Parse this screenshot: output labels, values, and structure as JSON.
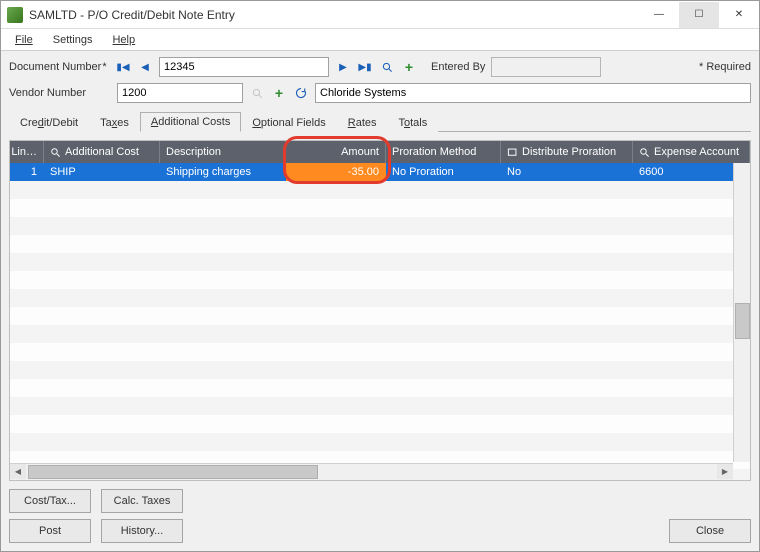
{
  "window": {
    "title": "SAMLTD - P/O Credit/Debit Note Entry"
  },
  "menu": {
    "file": "File",
    "settings": "Settings",
    "help": "Help"
  },
  "header": {
    "doc_label": "Document Number",
    "doc_value": "12345",
    "entered_by_label": "Entered By",
    "entered_by_value": "",
    "required_hint": "Required",
    "vendor_label": "Vendor Number",
    "vendor_value": "1200",
    "vendor_name": "Chloride Systems"
  },
  "tabs": [
    {
      "label": "Credit/Debit"
    },
    {
      "label": "Taxes"
    },
    {
      "label": "Additional Costs"
    },
    {
      "label": "Optional Fields"
    },
    {
      "label": "Rates"
    },
    {
      "label": "Totals"
    }
  ],
  "grid": {
    "columns": {
      "lin": "Lin…",
      "addcost": "Additional Cost",
      "desc": "Description",
      "amount": "Amount",
      "proration": "Proration Method",
      "distribute": "Distribute Proration",
      "expense": "Expense Account"
    },
    "rows": [
      {
        "line": "1",
        "addcost": "SHIP",
        "desc": "Shipping charges",
        "amount": "-35.00",
        "proration": "No Proration",
        "distribute": "No",
        "expense": "6600"
      }
    ]
  },
  "buttons": {
    "cost_tax": "Cost/Tax...",
    "calc_taxes": "Calc. Taxes",
    "post": "Post",
    "history": "History...",
    "close": "Close"
  }
}
